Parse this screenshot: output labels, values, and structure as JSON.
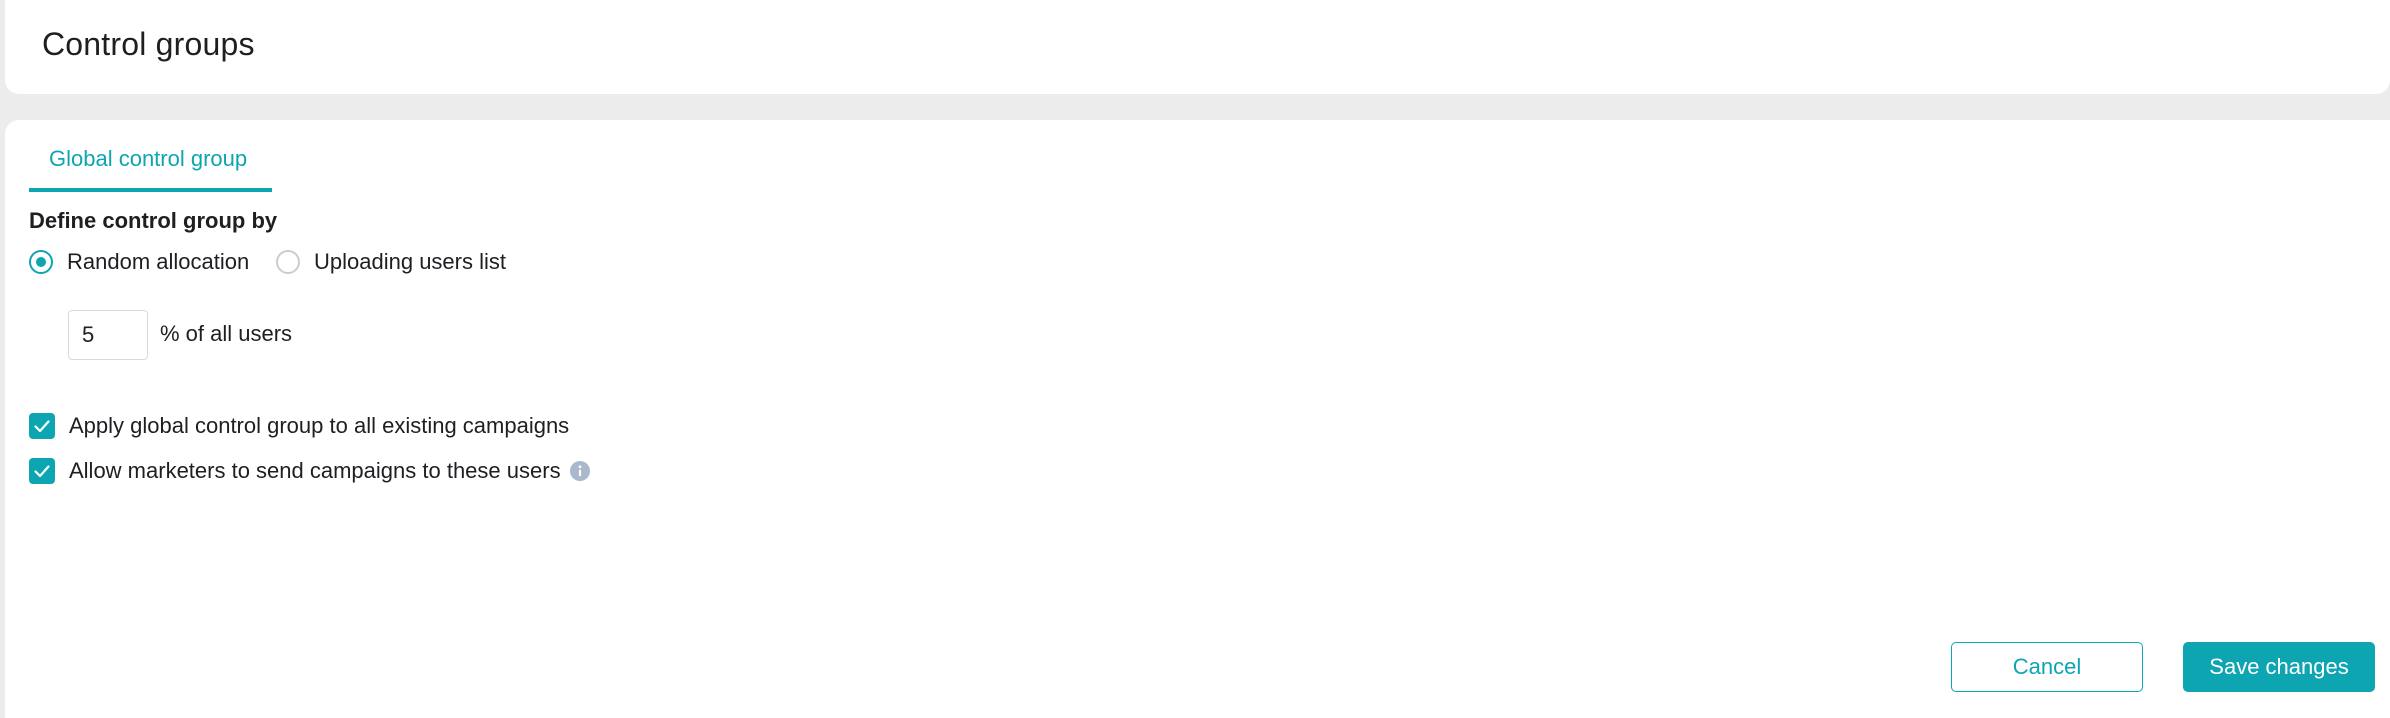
{
  "header": {
    "title": "Control groups"
  },
  "tabs": [
    {
      "label": "Global control group",
      "active": true
    }
  ],
  "form": {
    "section_label": "Define control group by",
    "options": [
      {
        "label": "Random allocation",
        "selected": true
      },
      {
        "label": "Uploading users list",
        "selected": false
      }
    ],
    "percent": {
      "value": "5",
      "suffix": "% of all users"
    },
    "checkboxes": [
      {
        "label": "Apply global control group to all existing campaigns",
        "checked": true
      },
      {
        "label": "Allow marketers to send campaigns to these users",
        "checked": true,
        "has_info": true
      }
    ]
  },
  "actions": {
    "cancel_label": "Cancel",
    "save_label": "Save changes"
  },
  "colors": {
    "accent": "#0ea5b3",
    "background": "#ececec",
    "card": "#ffffff",
    "info_icon": "#a9b8cd"
  },
  "icons": {
    "checkmark": "check-icon",
    "info": "info-icon"
  }
}
